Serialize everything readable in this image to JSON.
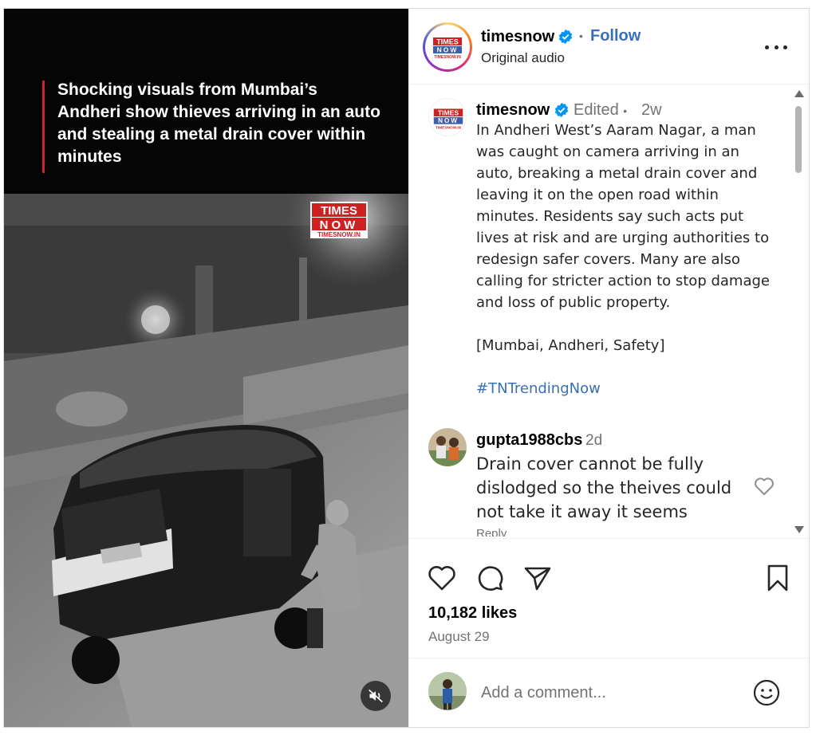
{
  "media": {
    "caption": "Shocking visuals from Mumbai’s Andheri show thieves arriving in an auto and stealing a metal drain cover within minutes",
    "logo_text": [
      "TIMES",
      "NOW",
      "TIMESNOW.IN"
    ],
    "mute_icon": "speaker-muted-icon",
    "colors": {
      "caption_rule": "#d0261f",
      "logo_red": "#cc2222"
    }
  },
  "header": {
    "username": "timesnow",
    "separator": "•",
    "follow_label": "Follow",
    "audio": "Original audio",
    "verified_icon": "verified-badge-icon",
    "more_icon": "more-options-icon"
  },
  "caption_comment": {
    "username": "timesnow",
    "edited": "Edited",
    "separator": "•",
    "time": "2w",
    "body": "In Andheri West’s Aaram Nagar, a man was caught on camera arriving in an auto, breaking a metal drain cover and leaving it on the open road within minutes. Residents say such acts put lives at risk and are urging authorities to redesign safer covers. Many are also calling for stricter action to stop damage and loss of public property.",
    "tags": "[Mumbai, Andheri, Safety]",
    "hashtag": "#TNTrendingNow"
  },
  "comments": [
    {
      "username": "gupta1988cbs",
      "time": "2d",
      "body": "Drain cover cannot be fully dislodged so the theives could not take it away it seems",
      "reply_label": "Reply"
    }
  ],
  "actions": {
    "icons": [
      "heart-icon",
      "comment-icon",
      "share-icon",
      "bookmark-icon"
    ],
    "likes": "10,182 likes",
    "date": "August 29"
  },
  "composer": {
    "placeholder": "Add a comment...",
    "emoji_icon": "emoji-icon"
  },
  "colors": {
    "link_blue": "#3a6fb8",
    "secondary_text": "#737373",
    "border": "#dbdbdb"
  }
}
